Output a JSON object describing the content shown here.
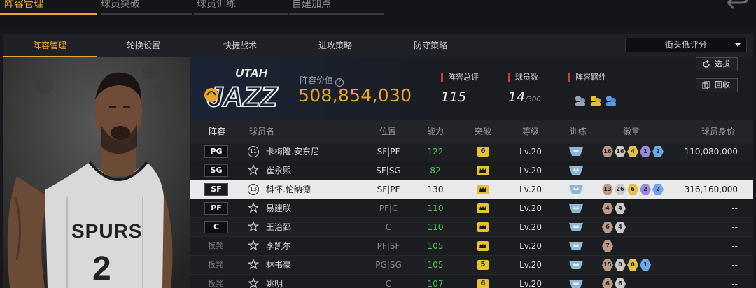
{
  "top_tabs": [
    {
      "label": "阵容管理",
      "active": true
    },
    {
      "label": "球员突破",
      "active": false
    },
    {
      "label": "球员训练",
      "active": false
    },
    {
      "label": "自建加点",
      "active": false
    }
  ],
  "sub_tabs": [
    {
      "label": "阵容管理",
      "active": true
    },
    {
      "label": "轮换设置",
      "active": false
    },
    {
      "label": "快捷战术",
      "active": false
    },
    {
      "label": "进攻策略",
      "active": false
    },
    {
      "label": "防守策略",
      "active": false
    }
  ],
  "sort_select": {
    "value": "街头低评分"
  },
  "team": {
    "logo_text": "UTAH JAZZ",
    "value_label": "阵容价值",
    "value": "508,854,030",
    "rating_label": "阵容总评",
    "rating": "115",
    "players_label": "球员数",
    "players": "14",
    "players_max": "/300",
    "bonds_label": "阵容羁绊",
    "select_button": "选拔",
    "recycle_button": "回收"
  },
  "table": {
    "headers": [
      "阵容",
      "球员名",
      "位置",
      "能力",
      "突破",
      "等级",
      "训练",
      "徽章",
      "球员身价"
    ],
    "rows": [
      {
        "slot": "PG",
        "bench": false,
        "jersey": "11",
        "name": "卡梅隆.安东尼",
        "pos": "SF|PF",
        "ability": "122",
        "ability_green": true,
        "breakthrough": "6",
        "level": "Lv.20",
        "badges": [
          {
            "n": "16",
            "c": "#b89a8a"
          },
          {
            "n": "16",
            "c": "#c9c9c9"
          },
          {
            "n": "4",
            "c": "#e0c24a"
          },
          {
            "n": "1",
            "c": "#9a8ad8"
          },
          {
            "n": "2",
            "c": "#6aa8e8"
          }
        ],
        "value": "110,080,000",
        "selected": false
      },
      {
        "slot": "SG",
        "bench": false,
        "jersey": "",
        "name": "崔永熙",
        "pos": "SF|SG",
        "ability": "82",
        "ability_green": true,
        "breakthrough": "",
        "level": "Lv.20",
        "badges": [],
        "value": "--",
        "selected": false
      },
      {
        "slot": "SF",
        "bench": false,
        "jersey": "13",
        "name": "科怀.伦纳德",
        "pos": "SF|PF",
        "ability": "130",
        "ability_green": false,
        "breakthrough": "",
        "level": "Lv.20",
        "badges": [
          {
            "n": "13",
            "c": "#b89a8a"
          },
          {
            "n": "26",
            "c": "#c9c9c9"
          },
          {
            "n": "6",
            "c": "#e0c24a"
          },
          {
            "n": "2",
            "c": "#9a8ad8"
          },
          {
            "n": "2",
            "c": "#6aa8e8"
          }
        ],
        "value": "316,160,000",
        "selected": true
      },
      {
        "slot": "PF",
        "bench": false,
        "jersey": "",
        "name": "易建联",
        "pos": "PF|C",
        "ability": "110",
        "ability_green": true,
        "breakthrough": "",
        "level": "Lv.20",
        "badges": [
          {
            "n": "4",
            "c": "#b89a8a"
          },
          {
            "n": "4",
            "c": "#c9c9c9"
          }
        ],
        "value": "--",
        "selected": false
      },
      {
        "slot": "C",
        "bench": false,
        "jersey": "",
        "name": "王治郅",
        "pos": "C",
        "ability": "110",
        "ability_green": true,
        "breakthrough": "",
        "level": "Lv.20",
        "badges": [
          {
            "n": "6",
            "c": "#b89a8a"
          },
          {
            "n": "4",
            "c": "#c9c9c9"
          }
        ],
        "value": "--",
        "selected": false
      },
      {
        "slot": "板凳",
        "bench": true,
        "jersey": "",
        "name": "李凯尔",
        "pos": "PF|SF",
        "ability": "105",
        "ability_green": true,
        "breakthrough": "",
        "level": "Lv.20",
        "badges": [
          {
            "n": "7",
            "c": "#b89a8a"
          }
        ],
        "value": "--",
        "selected": false
      },
      {
        "slot": "板凳",
        "bench": true,
        "jersey": "",
        "name": "林书豪",
        "pos": "PG|SG",
        "ability": "105",
        "ability_green": true,
        "breakthrough": "5",
        "level": "Lv.20",
        "badges": [
          {
            "n": "15",
            "c": "#b89a8a"
          },
          {
            "n": "0",
            "c": "#c9c9c9"
          },
          {
            "n": "0",
            "c": "#e0c24a"
          },
          {
            "n": "1",
            "c": "#6aa8e8"
          }
        ],
        "value": "--",
        "selected": false
      },
      {
        "slot": "板凳",
        "bench": true,
        "jersey": "",
        "name": "姚明",
        "pos": "C",
        "ability": "107",
        "ability_green": true,
        "breakthrough": "6",
        "level": "Lv.20",
        "badges": [
          {
            "n": "6",
            "c": "#b89a8a"
          },
          {
            "n": "6",
            "c": "#c9c9c9"
          }
        ],
        "value": "--",
        "selected": false
      }
    ]
  },
  "colors": {
    "accent": "#e6a52b",
    "green": "#4fc24f",
    "gold_badge": "#e6c22e",
    "stat_marker": "#d23a3a"
  }
}
